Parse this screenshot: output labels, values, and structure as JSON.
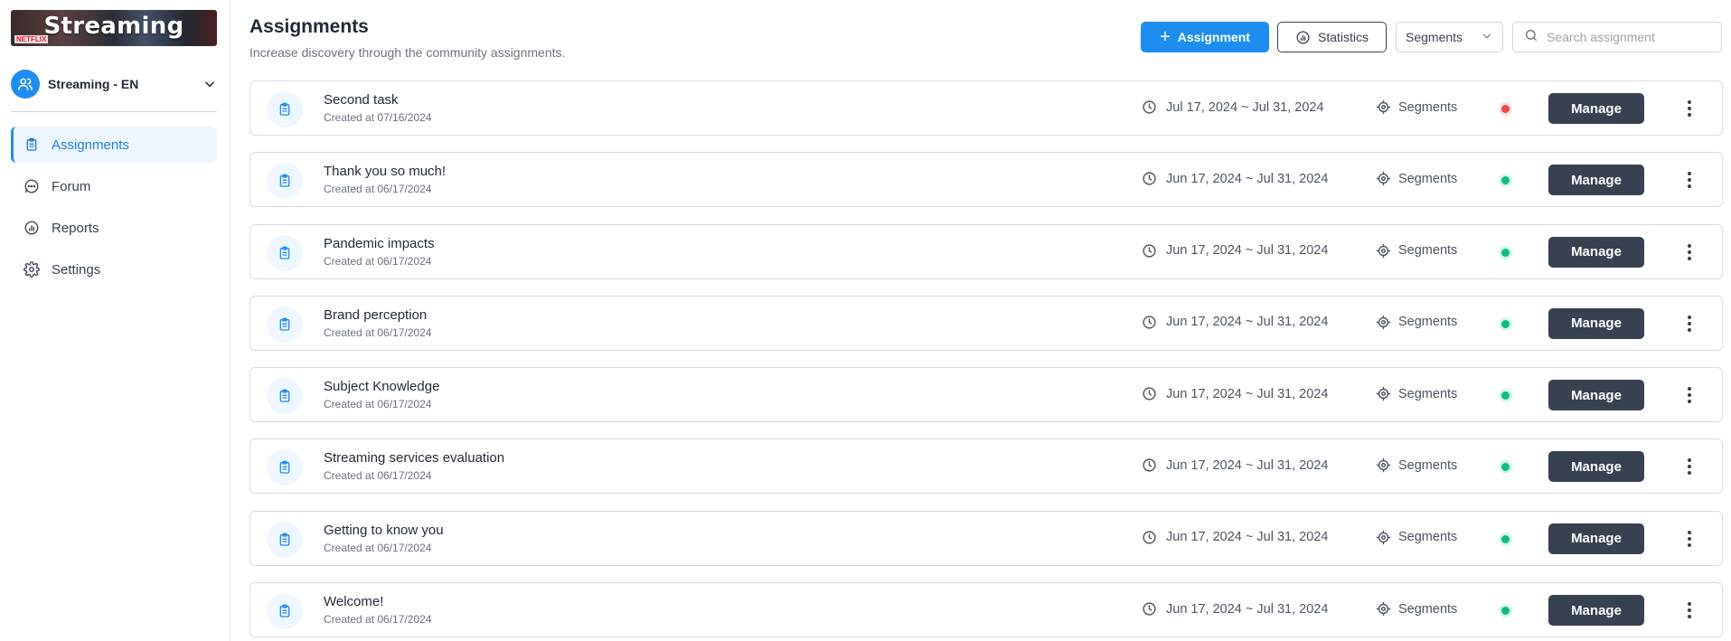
{
  "sidebar": {
    "brand_title": "Streaming",
    "brand_badge": "NETFLIX",
    "workspace_name": "Streaming - EN",
    "items": [
      {
        "label": "Assignments",
        "icon": "clipboard-icon",
        "active": true
      },
      {
        "label": "Forum",
        "icon": "chat-bubble-icon",
        "active": false
      },
      {
        "label": "Reports",
        "icon": "pie-chart-icon",
        "active": false
      },
      {
        "label": "Settings",
        "icon": "gear-icon",
        "active": false
      }
    ]
  },
  "header": {
    "title": "Assignments",
    "subtitle": "Increase discovery through the community assignments.",
    "add_button": "Assignment",
    "stats_button": "Statistics",
    "segments_select": "Segments",
    "search_placeholder": "Search assignment"
  },
  "assignments": [
    {
      "title": "Second task",
      "created": "Created at 07/16/2024",
      "date_range": "Jul 17, 2024 ~ Jul 31, 2024",
      "segments": "Segments",
      "status": "red",
      "action": "Manage"
    },
    {
      "title": "Thank you so much!",
      "created": "Created at 06/17/2024",
      "date_range": "Jun 17, 2024 ~ Jul 31, 2024",
      "segments": "Segments",
      "status": "green",
      "action": "Manage"
    },
    {
      "title": "Pandemic impacts",
      "created": "Created at 06/17/2024",
      "date_range": "Jun 17, 2024 ~ Jul 31, 2024",
      "segments": "Segments",
      "status": "green",
      "action": "Manage"
    },
    {
      "title": "Brand perception",
      "created": "Created at 06/17/2024",
      "date_range": "Jun 17, 2024 ~ Jul 31, 2024",
      "segments": "Segments",
      "status": "green",
      "action": "Manage"
    },
    {
      "title": "Subject Knowledge",
      "created": "Created at 06/17/2024",
      "date_range": "Jun 17, 2024 ~ Jul 31, 2024",
      "segments": "Segments",
      "status": "green",
      "action": "Manage"
    },
    {
      "title": "Streaming services evaluation",
      "created": "Created at 06/17/2024",
      "date_range": "Jun 17, 2024 ~ Jul 31, 2024",
      "segments": "Segments",
      "status": "green",
      "action": "Manage"
    },
    {
      "title": "Getting to know you",
      "created": "Created at 06/17/2024",
      "date_range": "Jun 17, 2024 ~ Jul 31, 2024",
      "segments": "Segments",
      "status": "green",
      "action": "Manage"
    },
    {
      "title": "Welcome!",
      "created": "Created at 06/17/2024",
      "date_range": "Jun 17, 2024 ~ Jul 31, 2024",
      "segments": "Segments",
      "status": "green",
      "action": "Manage"
    }
  ],
  "colors": {
    "accent": "#1d8ef0",
    "dark_button": "#374151",
    "status_green": "#10b981",
    "status_red": "#ef4444"
  }
}
